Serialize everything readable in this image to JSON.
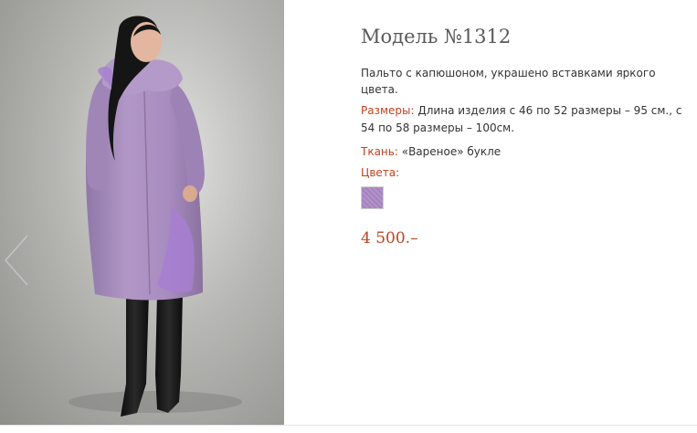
{
  "product": {
    "title": "Модель №1312",
    "description": "Пальто с капюшоном, украшено вставками яркого цвета.",
    "sizes_label": "Размеры:",
    "sizes_value": "Длина изделия с 46 по 52 размеры – 95 см., с 54 по 58 размеры – 100см.",
    "fabric_label": "Ткань:",
    "fabric_value": "«Вареное» букле",
    "colors_label": "Цвета:",
    "colors": [
      {
        "name": "lilac",
        "hex": "#b293c9"
      }
    ],
    "price": "4 500.–"
  },
  "gallery": {
    "prev_icon": "chevron-left-icon"
  },
  "theme": {
    "accent": "#c0421e",
    "title_color": "#595959",
    "text_color": "#333333"
  }
}
